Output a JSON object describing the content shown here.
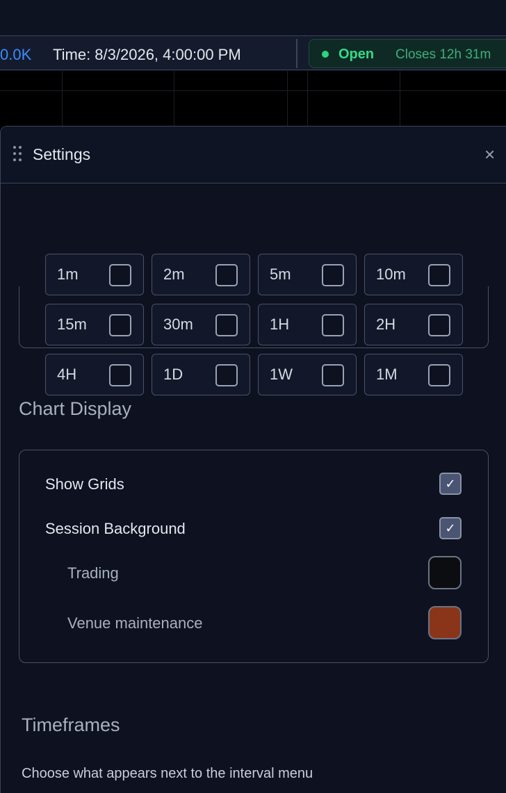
{
  "statusbar": {
    "volume": "0.0K",
    "time": "Time: 8/3/2026, 4:00:00 PM",
    "market_status": "Open",
    "closes": "Closes 12h 31m"
  },
  "settings": {
    "title": "Settings",
    "close_label": "×",
    "timeframe_options": [
      "1m",
      "2m",
      "5m",
      "10m",
      "15m",
      "30m",
      "1H",
      "2H",
      "4H",
      "1D",
      "1W",
      "1M"
    ],
    "chart_display": {
      "heading": "Chart Display",
      "show_grids": {
        "label": "Show Grids",
        "checked": true
      },
      "session_background": {
        "label": "Session Background",
        "checked": true
      },
      "trading": {
        "label": "Trading",
        "color": "#0c0d10"
      },
      "venue_maintenance": {
        "label": "Venue maintenance",
        "color": "#8a351a"
      }
    },
    "timeframes": {
      "heading": "Timeframes",
      "description": "Choose what appears next to the interval menu"
    }
  },
  "colors": {
    "accent_blue": "#3b8cff",
    "open_green": "#34d98a",
    "panel_bg": "#0d1120"
  }
}
